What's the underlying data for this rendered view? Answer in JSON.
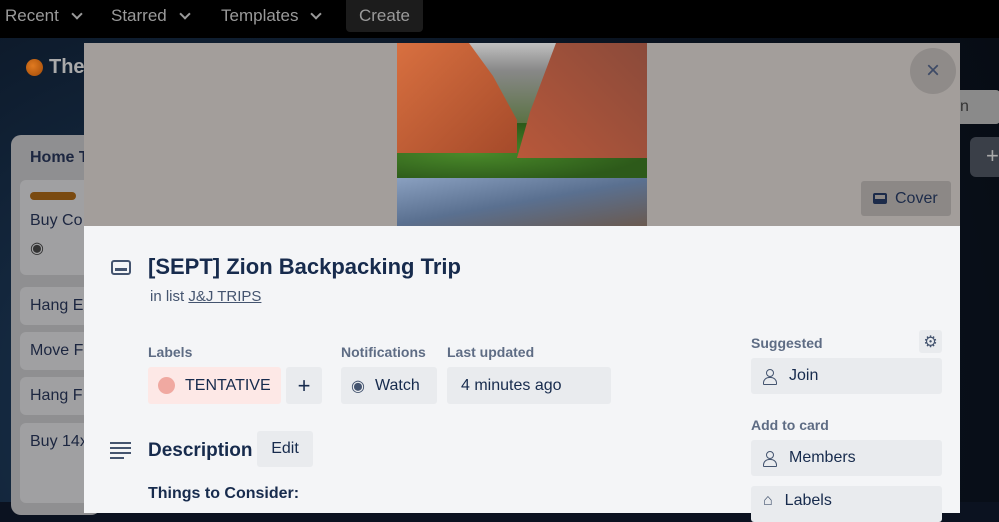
{
  "topnav": {
    "recent": "Recent",
    "starred": "Starred",
    "templates": "Templates",
    "create": "Create"
  },
  "board": {
    "title": "The",
    "list_title": "Home T",
    "cards": [
      "Buy Co",
      "Hang E",
      "Move F",
      "Hang F",
      "Buy 14x"
    ],
    "right_button": "n",
    "add": "+"
  },
  "modal": {
    "cover_button": "Cover",
    "close": "×",
    "title": "[SEPT] Zion Backpacking Trip",
    "in_list_prefix": "in list",
    "list_name": "J&J TRIPS",
    "labels_heading": "Labels",
    "label": "TENTATIVE",
    "label_color": "#f0a9a1",
    "add_label": "+",
    "notifications_heading": "Notifications",
    "watch": "Watch",
    "last_updated_heading": "Last updated",
    "last_updated": "4 minutes ago",
    "description_heading": "Description",
    "edit": "Edit",
    "description_first_line": "Things to Consider:",
    "sidebar": {
      "suggested": "Suggested",
      "join": "Join",
      "add_to_card": "Add to card",
      "members": "Members",
      "labels": "Labels"
    }
  }
}
